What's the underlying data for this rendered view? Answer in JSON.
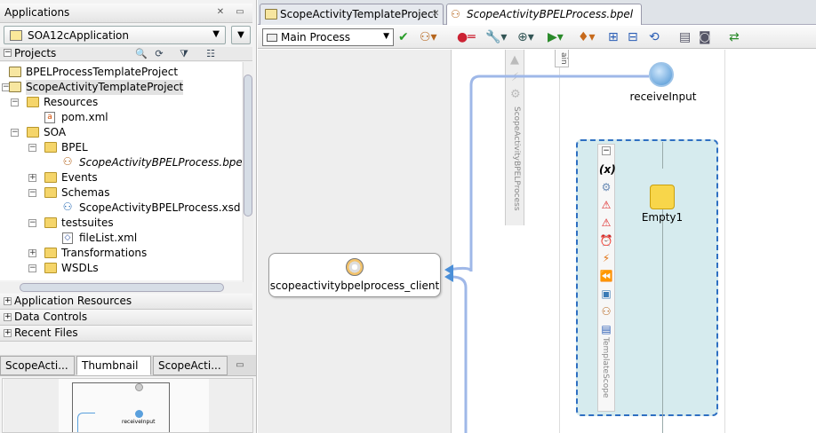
{
  "left_panel": {
    "applications_title": "Applications",
    "app_selector": "SOA12cApplication",
    "projects_label": "Projects",
    "tree": [
      {
        "label": "BPELProcessTemplateProject",
        "icon": "project-folder-icon"
      },
      {
        "label": "ScopeActivityTemplateProject",
        "icon": "project-folder-icon"
      },
      {
        "label": "Resources",
        "icon": "folder-icon"
      },
      {
        "label": "pom.xml",
        "icon": "xml-file-icon"
      },
      {
        "label": "SOA",
        "icon": "folder-icon"
      },
      {
        "label": "BPEL",
        "icon": "folder-icon"
      },
      {
        "label": "ScopeActivityBPELProcess.bpel",
        "icon": "bpel-process-icon"
      },
      {
        "label": "Events",
        "icon": "folder-icon"
      },
      {
        "label": "Schemas",
        "icon": "folder-icon"
      },
      {
        "label": "ScopeActivityBPELProcess.xsd",
        "icon": "xsd-file-icon"
      },
      {
        "label": "testsuites",
        "icon": "folder-icon"
      },
      {
        "label": "fileList.xml",
        "icon": "xml-file-icon"
      },
      {
        "label": "Transformations",
        "icon": "folder-icon"
      },
      {
        "label": "WSDLs",
        "icon": "folder-icon"
      }
    ],
    "accordions": [
      "Application Resources",
      "Data Controls",
      "Recent Files"
    ],
    "bottom_tabs": [
      "ScopeActi...",
      "Thumbnail",
      "ScopeActi..."
    ],
    "thumbnail_label": "receiveInput"
  },
  "editor": {
    "tabs": [
      "ScopeActivityTemplateProject",
      "ScopeActivityBPELProcess.bpel"
    ],
    "process_selector": "Main Process",
    "lane_label": "ScopeActivityBPELProcess",
    "lane_tag": "ain",
    "partner_link": "scopeactivitybpelprocess_client",
    "receive_label": "receiveInput",
    "scope_label": "TemplateScope",
    "empty_label": "Empty1"
  }
}
